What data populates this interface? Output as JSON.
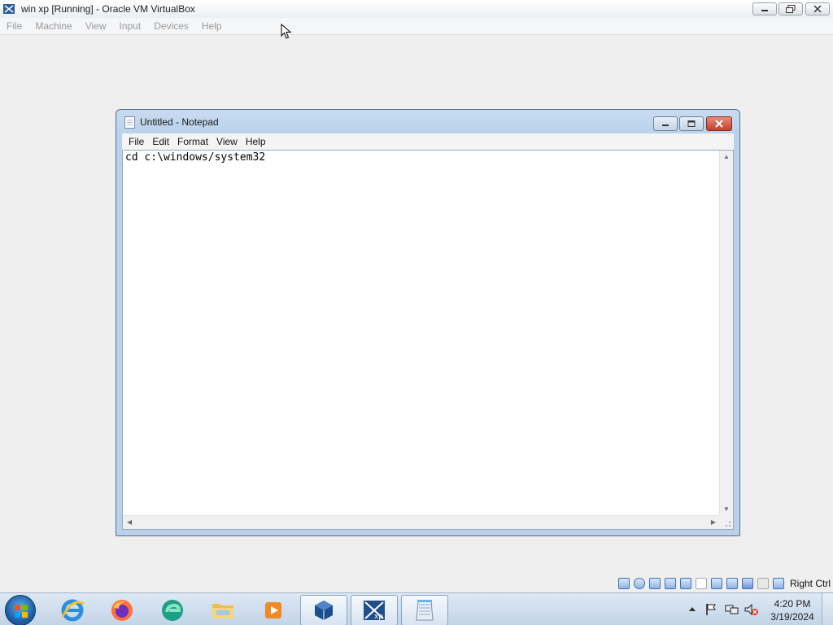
{
  "vbox": {
    "title": "win xp [Running] - Oracle VM VirtualBox",
    "menu": [
      "File",
      "Machine",
      "View",
      "Input",
      "Devices",
      "Help"
    ],
    "host_key": "Right Ctrl"
  },
  "notepad": {
    "title": "Untitled - Notepad",
    "menu": [
      "File",
      "Edit",
      "Format",
      "View",
      "Help"
    ],
    "content": "cd c:\\windows/system32"
  },
  "taskbar": {
    "pinned": [
      {
        "name": "internet-explorer",
        "icon": "ie-icon"
      },
      {
        "name": "firefox",
        "icon": "firefox-icon"
      },
      {
        "name": "edge",
        "icon": "edge-icon"
      },
      {
        "name": "explorer",
        "icon": "folder-icon"
      },
      {
        "name": "media-player",
        "icon": "media-player-icon"
      },
      {
        "name": "virtualbox",
        "icon": "virtualbox-icon"
      },
      {
        "name": "virtualbox-xp",
        "icon": "xp-vm-icon"
      },
      {
        "name": "notepad",
        "icon": "notepad-icon"
      }
    ],
    "clock": {
      "time": "4:20 PM",
      "date": "3/19/2024"
    }
  },
  "colors": {
    "accent": "#1f5fa8",
    "close_red": "#c4402b"
  }
}
